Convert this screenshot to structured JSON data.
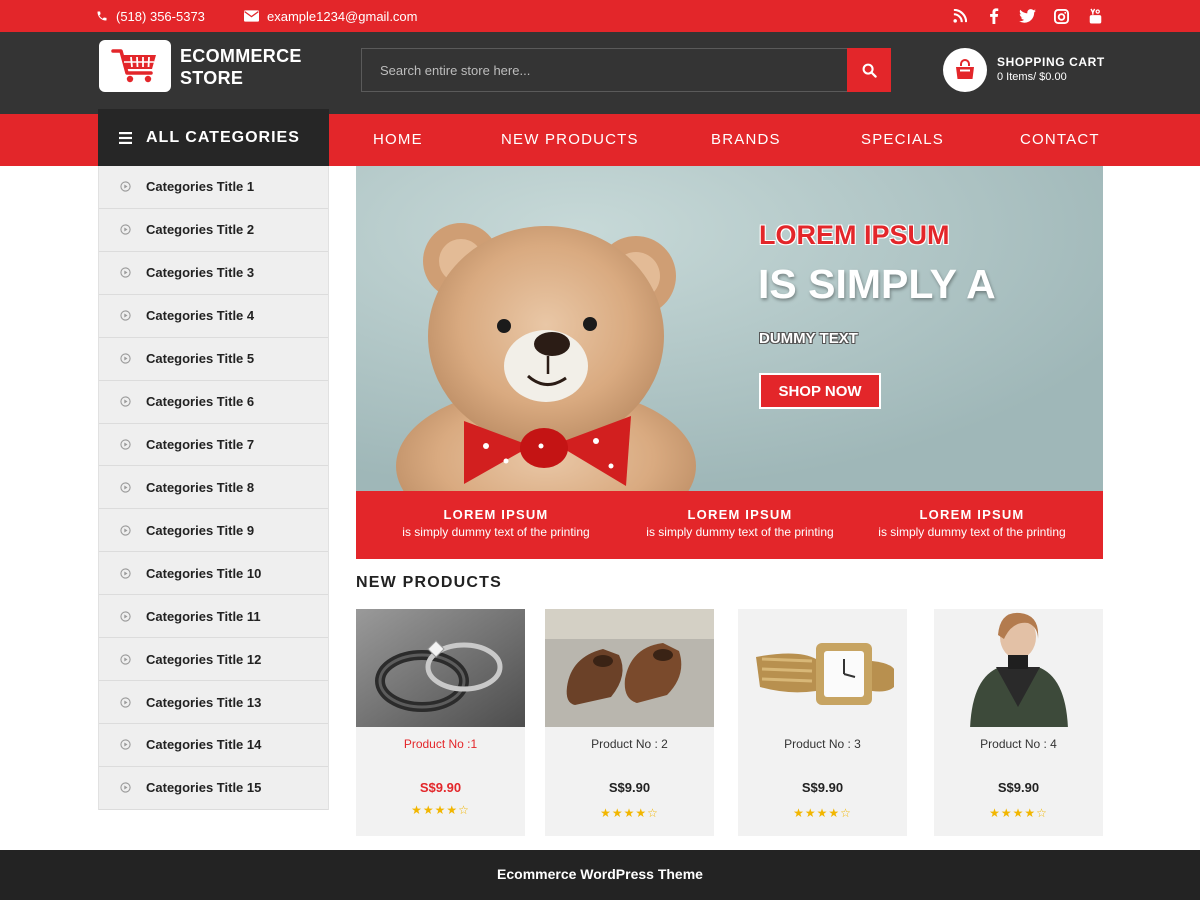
{
  "topbar": {
    "phone": "(518) 356-5373",
    "email": "example1234@gmail.com",
    "social_icons": [
      "rss-icon",
      "facebook-icon",
      "twitter-icon",
      "instagram-icon",
      "youtube-icon"
    ]
  },
  "header": {
    "logo_line1": "ECOMMERCE",
    "logo_line2": "STORE",
    "search_placeholder": "Search entire store here...",
    "cart_title": "SHOPPING CART",
    "cart_info": "0 Items/ $0.00"
  },
  "nav": {
    "all_categories": "ALL CATEGORIES",
    "links": [
      "HOME",
      "NEW PRODUCTS",
      "BRANDS",
      "SPECIALS",
      "CONTACT"
    ]
  },
  "sidebar": {
    "categories": [
      "Categories Title 1",
      "Categories Title 2",
      "Categories Title 3",
      "Categories Title 4",
      "Categories Title 5",
      "Categories Title 6",
      "Categories Title 7",
      "Categories Title 8",
      "Categories Title 9",
      "Categories Title 10",
      "Categories Title 11",
      "Categories Title 12",
      "Categories Title 13",
      "Categories Title 14",
      "Categories Title 15"
    ]
  },
  "hero": {
    "line1": "LOREM IPSUM",
    "line2": "IS SIMPLY A",
    "line3": "DUMMY TEXT",
    "button": "SHOP NOW"
  },
  "features": [
    {
      "title": "LOREM IPSUM",
      "subtitle": "is simply dummy text of the printing"
    },
    {
      "title": "LOREM IPSUM",
      "subtitle": "is simply dummy text of the printing"
    },
    {
      "title": "LOREM IPSUM",
      "subtitle": "is simply dummy text of the printing"
    }
  ],
  "products_section": {
    "title": "NEW PRODUCTS",
    "products": [
      {
        "name": "Product No :1",
        "price": "S$9.90",
        "rating": 4,
        "stars": "★★★★☆"
      },
      {
        "name": "Product No : 2",
        "price": "S$9.90",
        "rating": 4,
        "stars": "★★★★☆"
      },
      {
        "name": "Product No : 3",
        "price": "S$9.90",
        "rating": 4,
        "stars": "★★★★☆"
      },
      {
        "name": "Product No : 4",
        "price": "S$9.90",
        "rating": 4,
        "stars": "★★★★☆"
      }
    ]
  },
  "footer": {
    "text": "Ecommerce WordPress Theme"
  },
  "colors": {
    "accent": "#e3262a",
    "header_bg": "#343434",
    "dark": "#262626",
    "sidebar_bg": "#efefef",
    "star": "#f2b600"
  }
}
